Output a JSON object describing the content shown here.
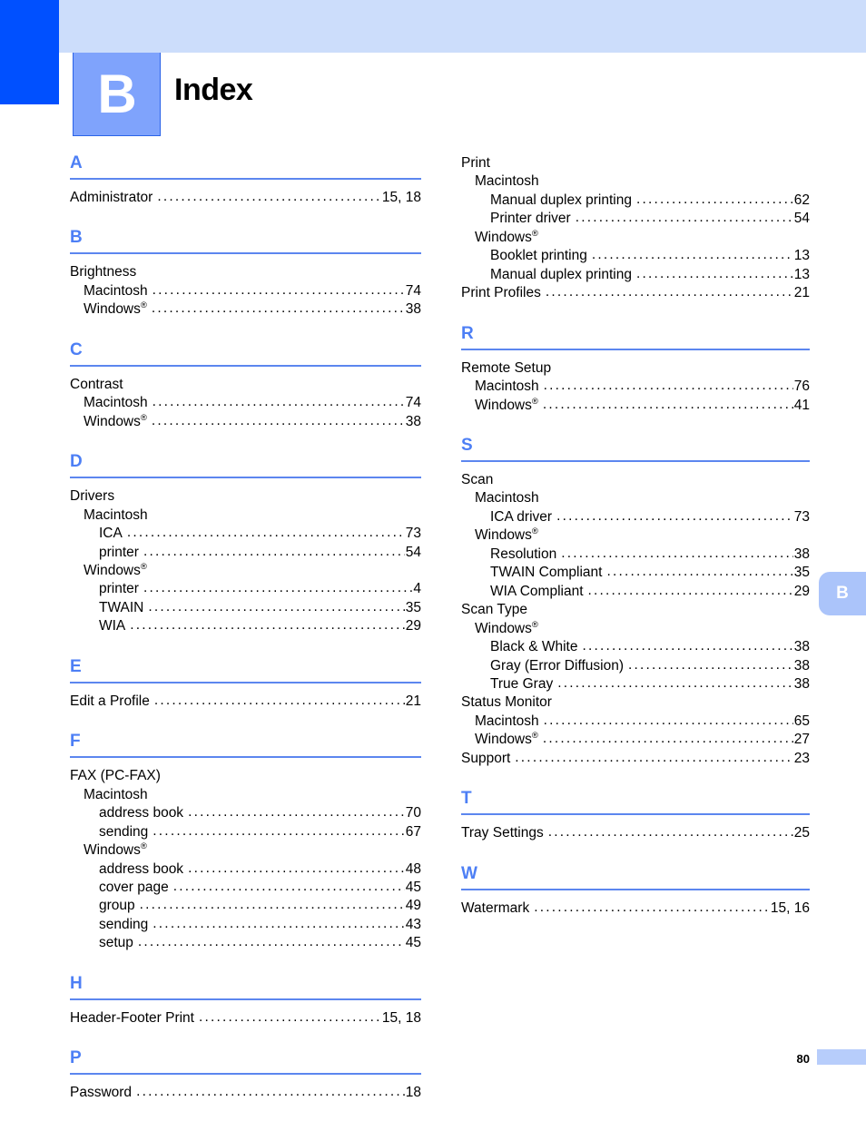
{
  "document": {
    "chapter_letter": "B",
    "title": "Index",
    "page_number": "80",
    "thumb_tab_letter": "B"
  },
  "colors": {
    "banner_dark": "#0050ff",
    "banner_light": "#ccddfb",
    "badge": "#7fa3fc",
    "heading": "#4d7ff5",
    "rule": "#5c86ef",
    "thumb_tab": "#abc4fa",
    "footer_bar": "#b7cdfb"
  },
  "columns": [
    {
      "name": "left",
      "sections": [
        {
          "heading": "A",
          "entries": [
            {
              "level": 0,
              "label": "Administrator",
              "pages": "15, 18"
            }
          ]
        },
        {
          "heading": "B",
          "entries": [
            {
              "level": 0,
              "label": "Brightness",
              "pages": ""
            },
            {
              "level": 1,
              "label": "Macintosh",
              "pages": "74"
            },
            {
              "level": 1,
              "label": "Windows",
              "reg": true,
              "pages": "38"
            }
          ]
        },
        {
          "heading": "C",
          "entries": [
            {
              "level": 0,
              "label": "Contrast",
              "pages": ""
            },
            {
              "level": 1,
              "label": "Macintosh",
              "pages": "74"
            },
            {
              "level": 1,
              "label": "Windows",
              "reg": true,
              "pages": "38"
            }
          ]
        },
        {
          "heading": "D",
          "entries": [
            {
              "level": 0,
              "label": "Drivers",
              "pages": ""
            },
            {
              "level": 1,
              "label": "Macintosh",
              "pages": ""
            },
            {
              "level": 2,
              "label": "ICA",
              "pages": "73"
            },
            {
              "level": 2,
              "label": "printer",
              "pages": "54"
            },
            {
              "level": 1,
              "label": "Windows",
              "reg": true,
              "pages": ""
            },
            {
              "level": 2,
              "label": "printer",
              "pages": "4"
            },
            {
              "level": 2,
              "label": "TWAIN",
              "pages": "35"
            },
            {
              "level": 2,
              "label": "WIA",
              "pages": "29"
            }
          ]
        },
        {
          "heading": "E",
          "entries": [
            {
              "level": 0,
              "label": "Edit a Profile",
              "pages": "21"
            }
          ]
        },
        {
          "heading": "F",
          "entries": [
            {
              "level": 0,
              "label": "FAX (PC-FAX)",
              "pages": ""
            },
            {
              "level": 1,
              "label": "Macintosh",
              "pages": ""
            },
            {
              "level": 2,
              "label": "address book",
              "pages": "70"
            },
            {
              "level": 2,
              "label": "sending",
              "pages": "67"
            },
            {
              "level": 1,
              "label": "Windows",
              "reg": true,
              "pages": ""
            },
            {
              "level": 2,
              "label": "address book",
              "pages": "48"
            },
            {
              "level": 2,
              "label": "cover page",
              "pages": "45"
            },
            {
              "level": 2,
              "label": "group",
              "pages": "49"
            },
            {
              "level": 2,
              "label": "sending",
              "pages": "43"
            },
            {
              "level": 2,
              "label": "setup",
              "pages": "45"
            }
          ]
        },
        {
          "heading": "H",
          "entries": [
            {
              "level": 0,
              "label": "Header-Footer Print",
              "pages": "15, 18"
            }
          ]
        },
        {
          "heading": "P",
          "entries": [
            {
              "level": 0,
              "label": "Password",
              "pages": "18"
            }
          ]
        }
      ]
    },
    {
      "name": "right",
      "sections": [
        {
          "heading": "",
          "entries": [
            {
              "level": 0,
              "label": "Print",
              "pages": ""
            },
            {
              "level": 1,
              "label": "Macintosh",
              "pages": ""
            },
            {
              "level": 2,
              "label": "Manual duplex printing",
              "pages": "62"
            },
            {
              "level": 2,
              "label": "Printer driver",
              "pages": "54"
            },
            {
              "level": 1,
              "label": "Windows",
              "reg": true,
              "pages": ""
            },
            {
              "level": 2,
              "label": "Booklet printing",
              "pages": "13"
            },
            {
              "level": 2,
              "label": "Manual duplex printing",
              "pages": "13"
            },
            {
              "level": 0,
              "label": "Print Profiles",
              "pages": "21"
            }
          ]
        },
        {
          "heading": "R",
          "entries": [
            {
              "level": 0,
              "label": "Remote Setup",
              "pages": ""
            },
            {
              "level": 1,
              "label": "Macintosh",
              "pages": "76"
            },
            {
              "level": 1,
              "label": "Windows",
              "reg": true,
              "pages": "41"
            }
          ]
        },
        {
          "heading": "S",
          "entries": [
            {
              "level": 0,
              "label": "Scan",
              "pages": ""
            },
            {
              "level": 1,
              "label": "Macintosh",
              "pages": ""
            },
            {
              "level": 2,
              "label": "ICA driver",
              "pages": "73"
            },
            {
              "level": 1,
              "label": "Windows",
              "reg": true,
              "pages": ""
            },
            {
              "level": 2,
              "label": "Resolution",
              "pages": "38"
            },
            {
              "level": 2,
              "label": "TWAIN Compliant",
              "pages": "35"
            },
            {
              "level": 2,
              "label": "WIA Compliant",
              "pages": "29"
            },
            {
              "level": 0,
              "label": "Scan Type",
              "pages": ""
            },
            {
              "level": 1,
              "label": "Windows",
              "reg": true,
              "pages": ""
            },
            {
              "level": 2,
              "label": "Black & White",
              "pages": "38"
            },
            {
              "level": 2,
              "label": "Gray (Error Diffusion)",
              "pages": "38"
            },
            {
              "level": 2,
              "label": "True Gray",
              "pages": "38"
            },
            {
              "level": 0,
              "label": "Status Monitor",
              "pages": ""
            },
            {
              "level": 1,
              "label": "Macintosh",
              "pages": "65"
            },
            {
              "level": 1,
              "label": "Windows",
              "reg": true,
              "pages": "27"
            },
            {
              "level": 0,
              "label": "Support",
              "pages": "23"
            }
          ]
        },
        {
          "heading": "T",
          "entries": [
            {
              "level": 0,
              "label": "Tray Settings",
              "pages": "25"
            }
          ]
        },
        {
          "heading": "W",
          "entries": [
            {
              "level": 0,
              "label": "Watermark",
              "pages": "15, 16"
            }
          ]
        }
      ]
    }
  ]
}
